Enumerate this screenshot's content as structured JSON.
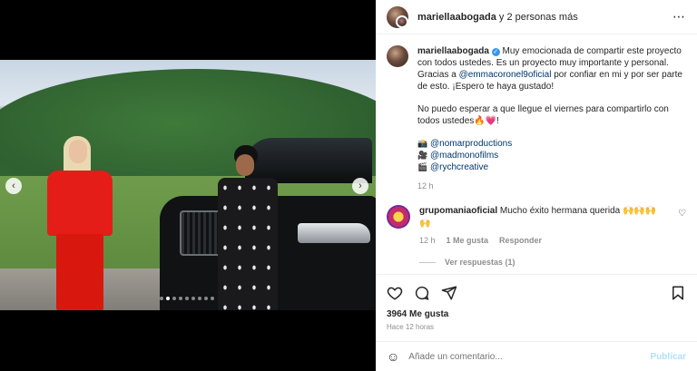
{
  "header": {
    "username": "mariellaabogada",
    "others": "y 2 personas más",
    "more_icon": "⋯"
  },
  "caption": {
    "username": "mariellaabogada",
    "verified_icon": "✓",
    "text1": "Muy emocionada de compartir este proyecto con todos ustedes. Es un proyecto muy importante y personal. Gracias a ",
    "mention": "@emmacoronel9oficial",
    "text2": " por confiar en mi y por ser parte de esto. ¡Espero te haya gustado!",
    "text3": "No puedo esperar a que llegue el viernes para compartirlo con todos ustedes🔥💗!",
    "credits": [
      {
        "icon": "📸",
        "handle": "@nomarproductions"
      },
      {
        "icon": "🎥",
        "handle": "@madmonofilms"
      },
      {
        "icon": "🎬",
        "handle": "@rychcreative"
      }
    ],
    "time": "12 h"
  },
  "comment": {
    "username": "grupomaniaoficial",
    "text": "Mucho éxito hermana querida 🙌🙌🙌🙌",
    "time": "12 h",
    "likes": "1 Me gusta",
    "reply": "Responder",
    "heart_icon": "♡",
    "view_replies": "Ver respuestas (1)"
  },
  "post": {
    "likes": "3964 Me gusta",
    "ago": "Hace 12 horas"
  },
  "add_comment": {
    "placeholder": "Añade un comentario...",
    "publish": "Publicar",
    "emoji_icon": "☺"
  },
  "media": {
    "prev_icon": "‹",
    "next_icon": "›",
    "slide_count": 9,
    "active_slide": 1
  }
}
